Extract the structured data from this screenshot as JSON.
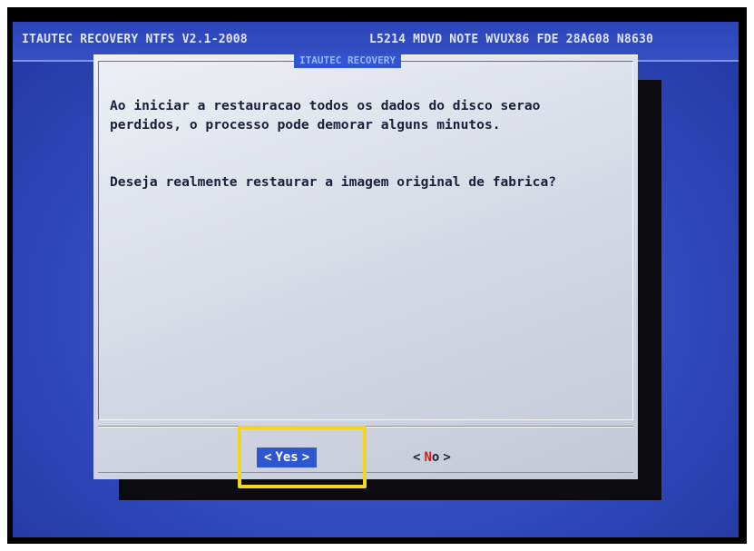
{
  "header": {
    "left_text": "ITAUTEC RECOVERY NTFS V2.1-2008",
    "right_text": "L5214 MDVD NOTE WVUX86 FDE 28AG08 N8630"
  },
  "dialog": {
    "title": "ITAUTEC RECOVERY",
    "message_line1": "Ao iniciar a restauracao todos  os dados do disco serao",
    "message_line2": "perdidos, o processo pode demorar alguns minutos.",
    "question": "Deseja realmente restaurar a imagem original de fabrica?"
  },
  "buttons": {
    "yes": {
      "left_bracket": "<",
      "label": "Yes",
      "right_bracket": ">",
      "selected": true
    },
    "no": {
      "left_bracket": "<",
      "hotkey": "N",
      "label_rest": "o",
      "right_bracket": ">",
      "selected": false
    }
  },
  "colors": {
    "screen_background": "#3550c4",
    "dialog_background": "#d4d8e4",
    "selected_button": "#2d56cf",
    "hotkey": "#d02020",
    "highlight_box": "#f3d51e"
  }
}
